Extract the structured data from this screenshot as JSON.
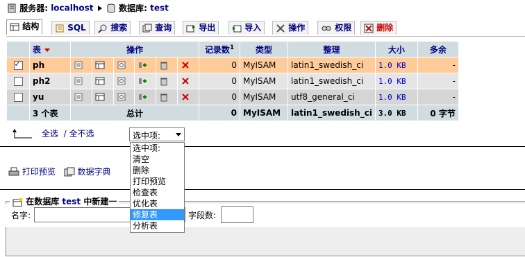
{
  "breadcrumb": {
    "server_label": "服务器:",
    "server_value": "localhost",
    "database_label": "数据库:",
    "database_value": "test"
  },
  "tabs": [
    {
      "label": "结构",
      "icon": "structure-icon",
      "active": true
    },
    {
      "label": "SQL",
      "icon": "sql-icon"
    },
    {
      "label": "搜索",
      "icon": "search-icon"
    },
    {
      "label": "查询",
      "icon": "query-icon"
    },
    {
      "label": "导出",
      "icon": "export-icon"
    },
    {
      "label": "导入",
      "icon": "import-icon"
    },
    {
      "label": "操作",
      "icon": "operations-icon"
    },
    {
      "label": "权限",
      "icon": "privileges-icon"
    },
    {
      "label": "删除",
      "icon": "drop-icon"
    }
  ],
  "table": {
    "headers": {
      "table": "表",
      "action": "操作",
      "records": "记录数",
      "records_sup": "1",
      "type": "类型",
      "collation": "整理",
      "size": "大小",
      "overhead": "多余"
    },
    "rows": [
      {
        "name": "ph",
        "checked": true,
        "records": "0",
        "type": "MyISAM",
        "collation": "latin1_swedish_ci",
        "size": "1.0 KB",
        "overhead": "-"
      },
      {
        "name": "ph2",
        "checked": false,
        "records": "0",
        "type": "MyISAM",
        "collation": "latin1_swedish_ci",
        "size": "1.0 KB",
        "overhead": "-"
      },
      {
        "name": "yu",
        "checked": false,
        "records": "0",
        "type": "MyISAM",
        "collation": "utf8_general_ci",
        "size": "1.0 KB",
        "overhead": "-"
      }
    ],
    "footer": {
      "count": "3 个表",
      "total": "总计",
      "records": "0",
      "type": "MyISAM",
      "collation": "latin1_swedish_ci",
      "size": "3.0 KB",
      "overhead": "0 字节"
    }
  },
  "select_all": "全选",
  "separator": "/",
  "select_none": "全不选",
  "with_selected": {
    "selected": "选中项:",
    "options": [
      "选中项:",
      "清空",
      "删除",
      "打印预览",
      "检查表",
      "优化表",
      "修复表",
      "分析表"
    ],
    "highlighted_index": 6
  },
  "print_view": "打印预览",
  "data_dictionary": "数据字典",
  "create_table": {
    "legend_prefix": "在数据库",
    "db": "test",
    "legend_suffix": "中新建一",
    "name_label": "名字:",
    "fields_label": "字段数:"
  },
  "colors": {
    "header_bg": "#d0dce0",
    "highlight_row": "#ffcc99",
    "link": "#000080",
    "dropdown_highlight": "#3399ff"
  }
}
